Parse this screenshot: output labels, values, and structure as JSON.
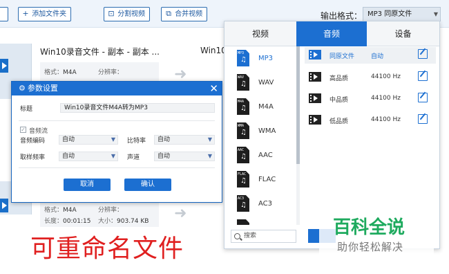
{
  "toolbar": {
    "add_folder": "添加文件夹",
    "split_video": "分割视频",
    "merge_video": "合并视频",
    "output_format_label": "输出格式：",
    "output_format_value": "MP3  同原文件"
  },
  "files": [
    {
      "name": "Win10录音文件 - 副本 - 副本 ...",
      "name_right": "Win10",
      "format": "M4A",
      "format_label": "格式：",
      "resolution_label": "分辨率：",
      "duration_label": "长度：",
      "duration": "00:01:15",
      "size_label": "大小：",
      "size": "903.74 KB"
    },
    {
      "format": "M4A",
      "format_label": "格式：",
      "resolution_label": "分辨率：",
      "duration_label": "长度：",
      "duration": "00:01:15",
      "size_label": "大小：",
      "size": "903.74 KB"
    }
  ],
  "dialog": {
    "title": "参数设置",
    "title_label": "标题",
    "title_value": "Win10录音文件M4A转为MP3",
    "audio_stream": "音频流",
    "codec_label": "音频编码",
    "codec_value": "自动",
    "bitrate_label": "比特率",
    "bitrate_value": "自动",
    "samplerate_label": "取样频率",
    "samplerate_value": "自动",
    "channel_label": "声道",
    "channel_value": "自动",
    "cancel": "取消",
    "confirm": "确认"
  },
  "panel": {
    "tabs": [
      "视频",
      "音频",
      "设备"
    ],
    "formats": [
      "MP3",
      "WAV",
      "M4A",
      "WMA",
      "AAC",
      "FLAC",
      "AC3"
    ],
    "qualities": [
      {
        "name": "同原文件",
        "rate": "自动"
      },
      {
        "name": "高品质",
        "rate": "44100 Hz"
      },
      {
        "name": "中品质",
        "rate": "44100 Hz"
      },
      {
        "name": "低品质",
        "rate": "44100 Hz"
      }
    ],
    "search_placeholder": "搜索"
  },
  "overlay": {
    "caption": "可重命名文件",
    "watermark_line1": "百科全说",
    "watermark_line2": "助你轻松解决"
  },
  "colors": {
    "accent": "#1c6fd1",
    "caption": "#e02020",
    "watermark": "#1eaa5e"
  }
}
